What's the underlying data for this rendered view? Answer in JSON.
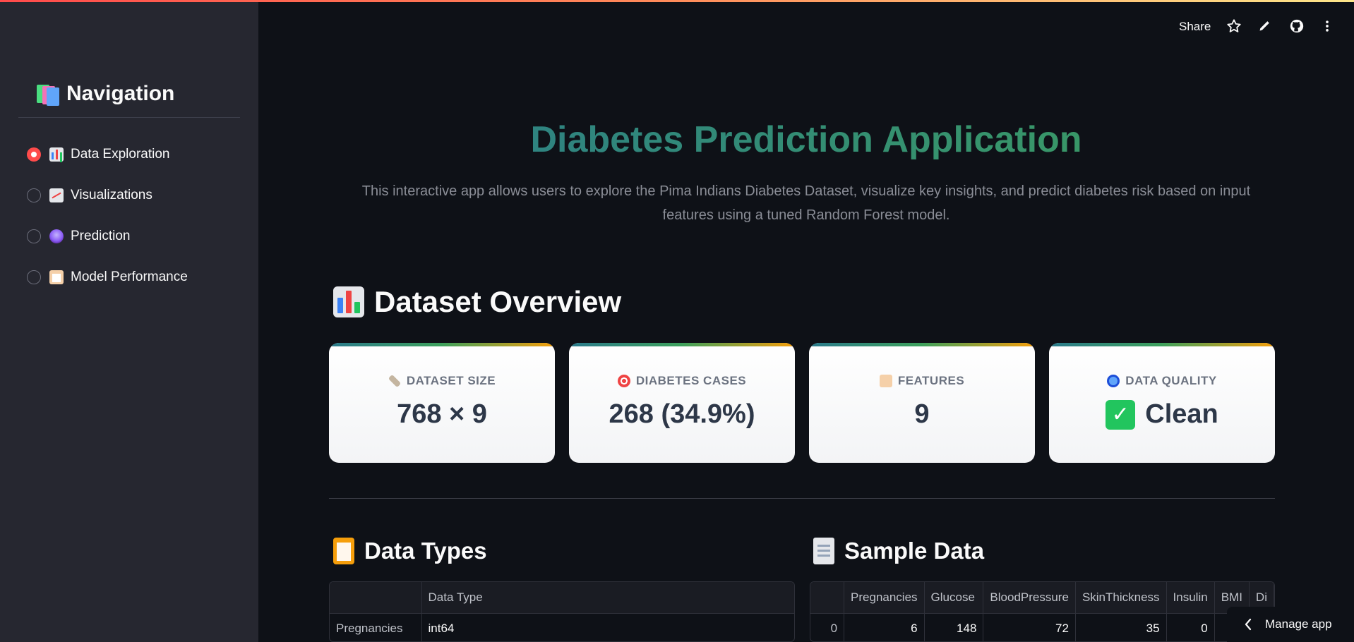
{
  "sidebar": {
    "title": "Navigation",
    "items": [
      {
        "label": "Data Exploration",
        "icon": "bar-chart-icon",
        "selected": true
      },
      {
        "label": "Visualizations",
        "icon": "line-chart-icon",
        "selected": false
      },
      {
        "label": "Prediction",
        "icon": "crystal-ball-icon",
        "selected": false
      },
      {
        "label": "Model Performance",
        "icon": "clipboard-icon",
        "selected": false
      }
    ]
  },
  "header": {
    "share_label": "Share",
    "icons": [
      "star-icon",
      "edit-icon",
      "github-icon",
      "more-icon"
    ]
  },
  "main": {
    "title": "Diabetes Prediction Application",
    "description": "This interactive app allows users to explore the Pima Indians Diabetes Dataset, visualize key insights, and predict diabetes risk based on input features using a tuned Random Forest model.",
    "overview_heading": "Dataset Overview",
    "cards": [
      {
        "label": "DATASET SIZE",
        "value": "768 × 9",
        "icon": "ruler-icon"
      },
      {
        "label": "DIABETES CASES",
        "value": "268 (34.9%)",
        "icon": "target-icon"
      },
      {
        "label": "FEATURES",
        "value": "9",
        "icon": "clipboard-icon"
      },
      {
        "label": "DATA QUALITY",
        "value": "Clean",
        "icon": "magnifier-icon"
      }
    ],
    "data_types": {
      "heading": "Data Types",
      "column": "Data Type",
      "rows": [
        {
          "name": "Pregnancies",
          "type": "int64"
        }
      ]
    },
    "sample_data": {
      "heading": "Sample Data",
      "columns": [
        "Pregnancies",
        "Glucose",
        "BloodPressure",
        "SkinThickness",
        "Insulin",
        "BMI",
        "Di"
      ],
      "rows": [
        {
          "index": "0",
          "values": [
            "6",
            "148",
            "72",
            "35",
            "0",
            "",
            ""
          ]
        }
      ]
    }
  },
  "footer": {
    "manage_label": "Manage app"
  },
  "colors": {
    "accent": "#ff4b4b",
    "title_start": "#2a7a8c",
    "title_end": "#3da05c",
    "background": "#0e1117",
    "sidebar": "#262730"
  }
}
